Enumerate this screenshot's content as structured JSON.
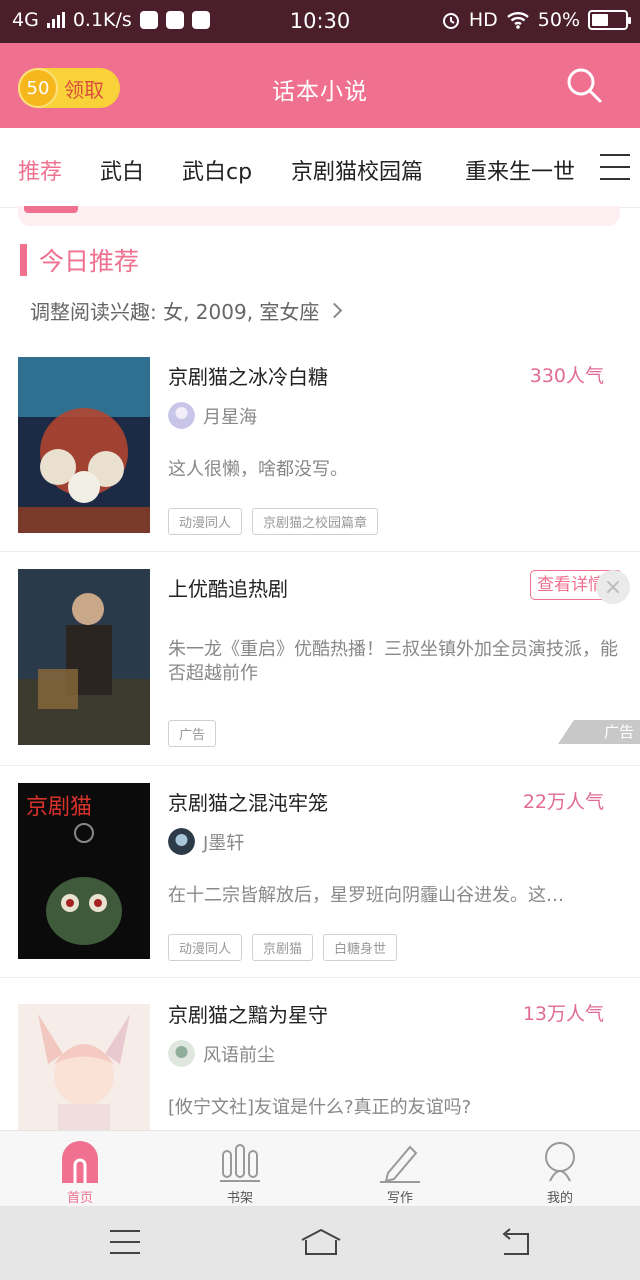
{
  "status_bar": {
    "network": "4G",
    "speed": "0.1K/s",
    "time": "10:30",
    "hd": "HD",
    "battery_text": "50%",
    "battery_level": 0.5
  },
  "header": {
    "coin_value": "50",
    "coin_label": "领取",
    "title": "话本小说"
  },
  "tabs": [
    "推荐",
    "武白",
    "武白cp",
    "京剧猫校园篇",
    "重来生一世"
  ],
  "section": {
    "title": "今日推荐",
    "interest_text": "调整阅读兴趣: 女, 2009, 室女座"
  },
  "books": [
    {
      "title": "京剧猫之冰冷白糖",
      "popularity": "330人气",
      "author": "月星海",
      "desc": "这人很懒，啥都没写。",
      "tags": [
        "动漫同人",
        "京剧猫之校园篇章"
      ]
    },
    {
      "title": "京剧猫之混沌牢笼",
      "popularity": "22万人气",
      "author": "J墨轩",
      "desc": "在十二宗皆解放后，星罗班向阴霾山谷进发。这…",
      "tags": [
        "动漫同人",
        "京剧猫",
        "白糖身世"
      ],
      "cover_text": "京剧猫"
    },
    {
      "title": "京剧猫之黯为星守",
      "popularity": "13万人气",
      "author": "风语前尘",
      "desc": "[攸宁文社]友谊是什么?真正的友谊吗?",
      "tags": []
    }
  ],
  "ad": {
    "title": "上优酷追热剧",
    "button": "查看详情",
    "desc": "朱一龙《重启》优酷热播！三叔坐镇外加全员演技派，能否超越前作",
    "tag": "广告",
    "mark": "广告"
  },
  "bottom_nav": [
    {
      "label": "首页",
      "icon": "home-icon",
      "active": true
    },
    {
      "label": "书架",
      "icon": "bookshelf-icon",
      "active": false
    },
    {
      "label": "写作",
      "icon": "pencil-icon",
      "active": false
    },
    {
      "label": "我的",
      "icon": "profile-icon",
      "active": false
    }
  ],
  "colors": {
    "accent": "#f0708f",
    "status_bar": "#4a1e2a",
    "popularity": "#e06b96"
  }
}
